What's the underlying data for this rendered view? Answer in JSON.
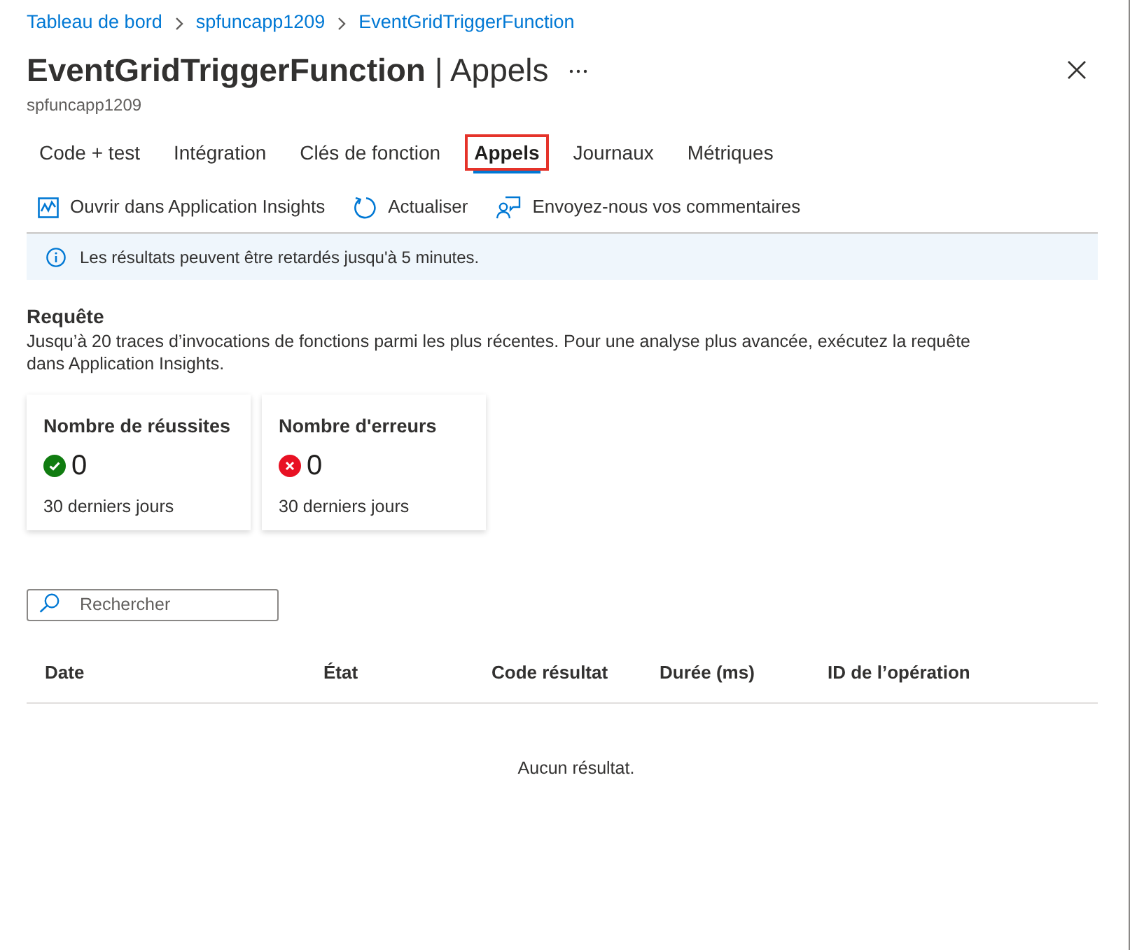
{
  "breadcrumb": [
    {
      "label": "Tableau de bord"
    },
    {
      "label": "spfuncapp1209"
    },
    {
      "label": "EventGridTriggerFunction"
    }
  ],
  "header": {
    "title": "**EventGridTriggerFunction** | Appels",
    "subtitle": "spfuncapp1209"
  },
  "tabs": [
    {
      "label": "Code + test",
      "selected": false,
      "highlighted": false
    },
    {
      "label": "Intégration",
      "selected": false,
      "highlighted": false
    },
    {
      "label": "Clés de fonction",
      "selected": false,
      "highlighted": false
    },
    {
      "label": "Appels",
      "selected": true,
      "highlighted": true
    },
    {
      "label": "Journaux",
      "selected": false,
      "highlighted": false
    },
    {
      "label": "Métriques",
      "selected": false,
      "highlighted": false
    }
  ],
  "toolbar": [
    {
      "kind": "insights",
      "label": "Ouvrir dans Application Insights"
    },
    {
      "kind": "refresh",
      "label": "Actualiser"
    },
    {
      "kind": "feedback",
      "label": "Envoyez-nous vos commentaires"
    }
  ],
  "notice": {
    "text": "Les résultats peuvent être retardés jusqu'à 5 minutes."
  },
  "query": {
    "heading": "Requête",
    "description": "Jusqu’à 20 traces d’invocations de fonctions parmi les plus récentes. Pour une analyse plus avancée, exécutez la requête dans Application Insights."
  },
  "cards": [
    {
      "kind": "success",
      "title": "Nombre de réussites",
      "count": "0",
      "period": "30 derniers jours"
    },
    {
      "kind": "error",
      "title": "Nombre d'erreurs",
      "count": "0",
      "period": "30 derniers jours"
    }
  ],
  "search": {
    "placeholder": "Rechercher"
  },
  "table": {
    "columns": [
      "Date",
      "État",
      "Code résultat",
      "Durée (ms)",
      "ID de l’opération"
    ],
    "empty_message": "Aucun résultat."
  }
}
